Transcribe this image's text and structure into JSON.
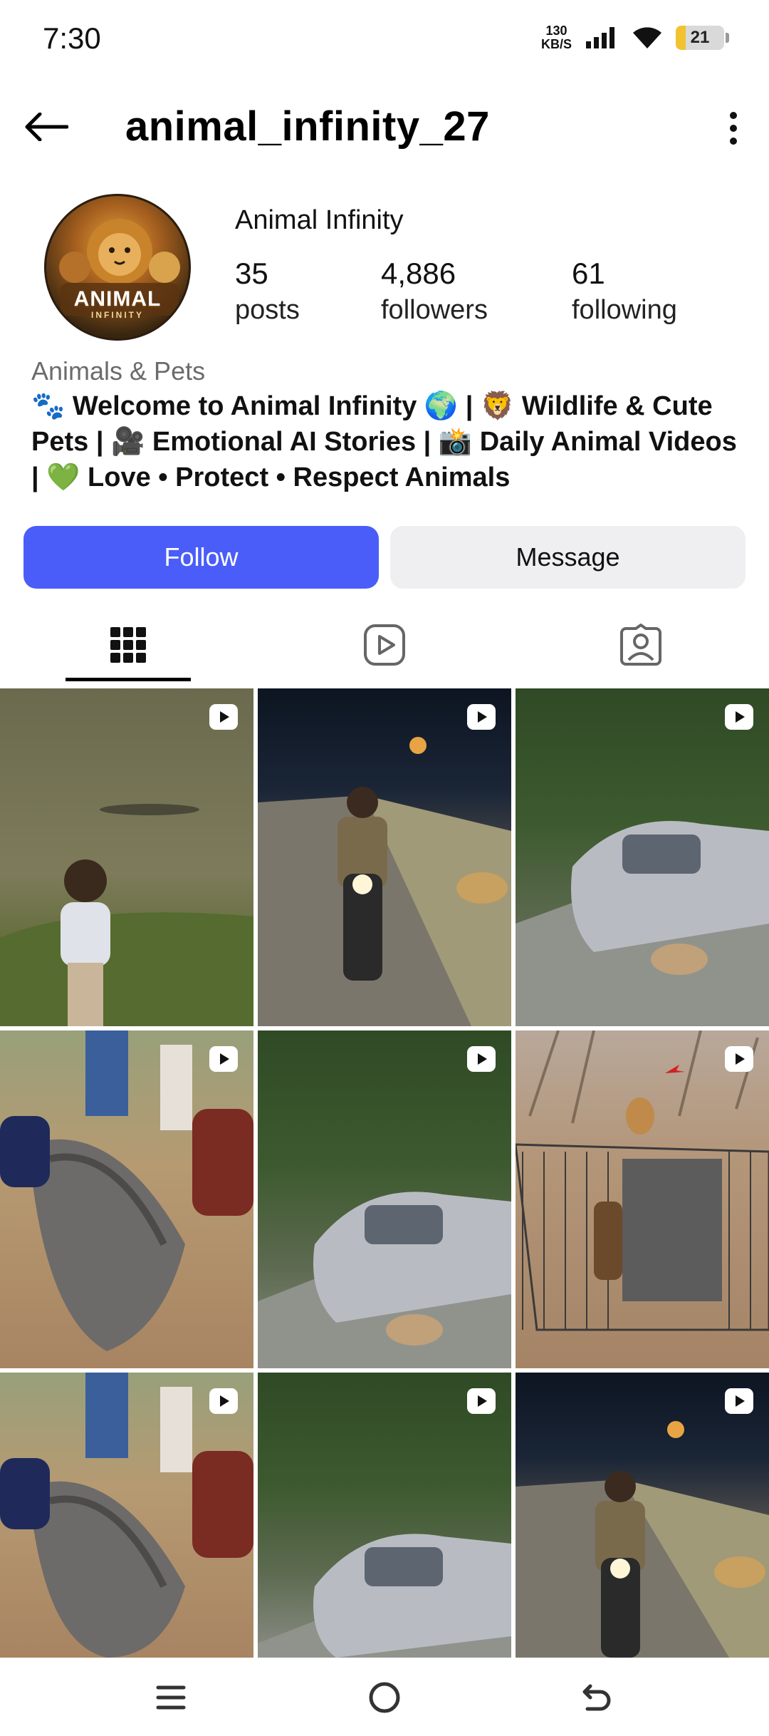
{
  "status_bar": {
    "time": "7:30",
    "net_speed_value": "130",
    "net_speed_unit": "KB/S",
    "battery_level": "21",
    "battery_fraction": 0.21
  },
  "header": {
    "username": "animal_infinity_27",
    "back_icon": "arrow-left-icon",
    "more_icon": "more-vertical-icon"
  },
  "profile": {
    "avatar_text": "ANIMAL",
    "avatar_subtext": "INFINITY",
    "display_name": "Animal Infinity",
    "stats": [
      {
        "value": "35",
        "label": "posts"
      },
      {
        "value": "4,886",
        "label": "followers"
      },
      {
        "value": "61",
        "label": "following"
      }
    ],
    "category": "Animals & Pets",
    "bio": "🐾 Welcome to Animal Infinity 🌍 | 🦁 Wildlife & Cute Pets | 🎥 Emotional AI Stories | 📸 Daily Animal Videos | 💚 Love • Protect • Respect Animals"
  },
  "actions": {
    "follow_label": "Follow",
    "message_label": "Message",
    "follow_color": "#4a5df9"
  },
  "tabs": [
    {
      "icon": "grid-icon",
      "active": true
    },
    {
      "icon": "reels-icon",
      "active": false
    },
    {
      "icon": "tagged-icon",
      "active": false
    }
  ],
  "posts": [
    {
      "subject": "child by river with crocodile",
      "type": "reel"
    },
    {
      "subject": "motorcyclist at night with leopard",
      "type": "reel"
    },
    {
      "subject": "car with animal attack",
      "type": "reel"
    },
    {
      "subject": "people with giant catfish",
      "type": "reel"
    },
    {
      "subject": "car with animal attack",
      "type": "reel"
    },
    {
      "subject": "lion and cage",
      "type": "reel"
    },
    {
      "subject": "people with giant catfish",
      "type": "reel"
    },
    {
      "subject": "car with animal attack",
      "type": "reel"
    },
    {
      "subject": "motorcyclist at night with leopard",
      "type": "reel"
    }
  ],
  "nav_bar": {
    "icons": [
      "menu-icon",
      "home-circle-icon",
      "back-icon"
    ]
  }
}
